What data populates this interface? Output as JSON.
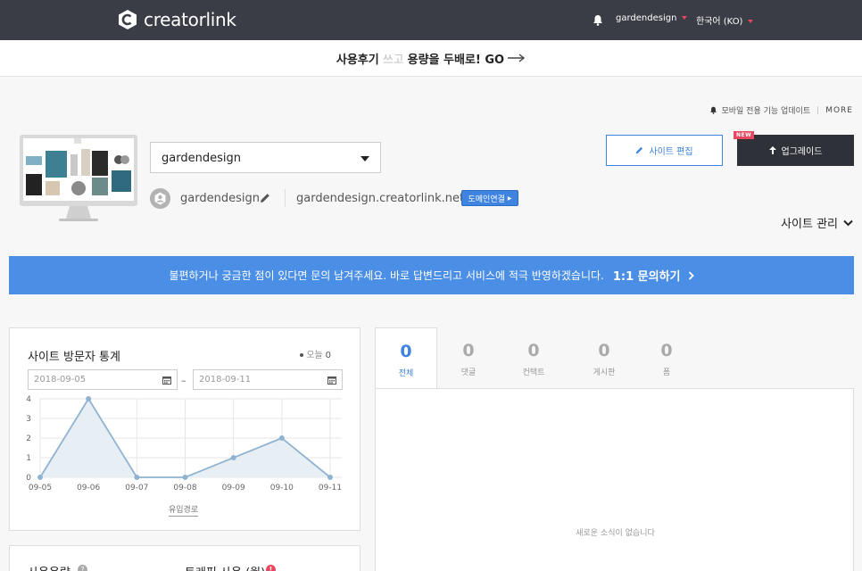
{
  "header": {
    "logo_text": "creatorlink",
    "user": "gardendesign",
    "language": "한국어 (KO)"
  },
  "promo": {
    "part1": "사용후기",
    "part2": "쓰고",
    "part3": "용량을 두배로! GO"
  },
  "notice": {
    "text": "모바일 전용 기능 업데이트",
    "more": "MORE"
  },
  "site": {
    "selected": "gardendesign",
    "username": "gardendesign",
    "domain": "gardendesign.creatorlink.net",
    "domain_button": "도메인연결",
    "edit_button": "사이트 편집",
    "upgrade_button": "업그레이드",
    "new_badge": "NEW",
    "manage": "사이트 관리"
  },
  "inquiry": {
    "text": "불편하거나 궁금한 점이 있다면 문의 남겨주세요. 바로 답변드리고 서비스에 적극 반영하겠습니다.",
    "link": "1:1 문의하기"
  },
  "stats": {
    "title": "사이트 방문자 통계",
    "today_label": "오늘",
    "today_value": "0",
    "date_from": "2018-09-05",
    "date_to": "2018-09-11",
    "date_sep": "–",
    "inflow_link": "유입경로"
  },
  "chart_data": {
    "type": "area",
    "x": [
      "09-05",
      "09-06",
      "09-07",
      "09-08",
      "09-09",
      "09-10",
      "09-11"
    ],
    "y_ticks": [
      0,
      1,
      2,
      3,
      4
    ],
    "ylim": [
      0,
      4
    ],
    "series": [
      {
        "values": [
          0,
          4,
          0,
          0,
          1,
          2,
          0
        ]
      }
    ],
    "grid": true,
    "colors": {
      "line": "#8fb3d0",
      "fill": "#e7eff5",
      "grid": "#e6e6e6"
    }
  },
  "usage": {
    "title": "사용용량",
    "help": "?",
    "traffic_title": "트래픽 사용 (월)",
    "traffic_alert": "!"
  },
  "feed": {
    "tabs": [
      {
        "count": "0",
        "label": "전체"
      },
      {
        "count": "0",
        "label": "댓글"
      },
      {
        "count": "0",
        "label": "컨택트"
      },
      {
        "count": "0",
        "label": "게시판"
      },
      {
        "count": "0",
        "label": "폼"
      }
    ],
    "empty": "새로운 소식이 없습니다"
  },
  "colors": {
    "nav_bg": "#3a3d45",
    "accent": "#3e84e0",
    "banner": "#4a8ee6",
    "alert": "#e8475f"
  }
}
